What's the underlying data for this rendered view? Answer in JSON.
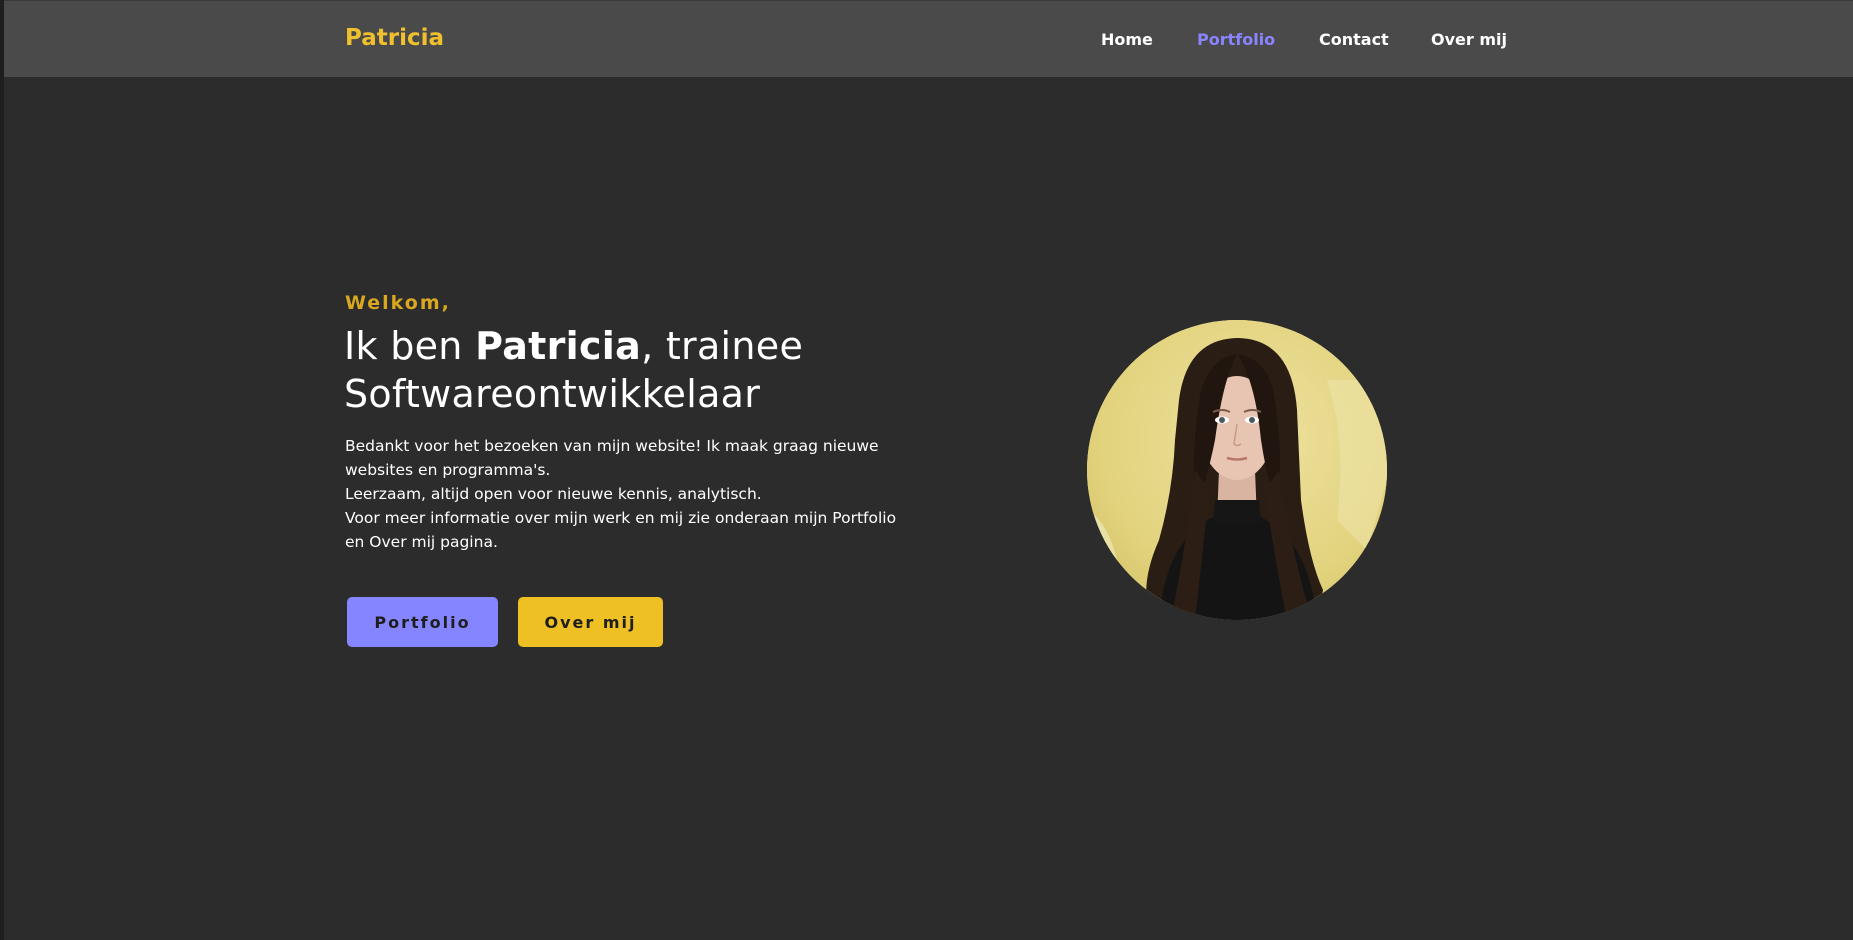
{
  "header": {
    "brand": "Patricia",
    "nav": [
      {
        "label": "Home",
        "active": false
      },
      {
        "label": "Portfolio",
        "active": true
      },
      {
        "label": "Contact",
        "active": false
      },
      {
        "label": "Over mij",
        "active": false
      }
    ]
  },
  "hero": {
    "greeting": "Welkom,",
    "headline_prefix": "Ik ben ",
    "headline_name": "Patricia",
    "headline_suffix": ", trainee Softwareontwikkelaar",
    "intro_lines": [
      "Bedankt voor het bezoeken van mijn website! Ik maak graag nieuwe websites en programma's.",
      "Leerzaam, altijd open voor nieuwe kennis, analytisch.",
      "Voor meer informatie over mijn werk en mij zie onderaan mijn Portfolio en Over mij pagina."
    ],
    "buttons": {
      "portfolio": "Portfolio",
      "over_mij": "Over mij"
    },
    "photo": "profile-photo"
  },
  "colors": {
    "background": "#2c2c2c",
    "navbar": "#4a4a4a",
    "brand": "#f0c12e",
    "nav_active": "#8a85ff",
    "greeting": "#d9a820",
    "button_purple": "#8585ff",
    "button_yellow": "#eec024"
  }
}
